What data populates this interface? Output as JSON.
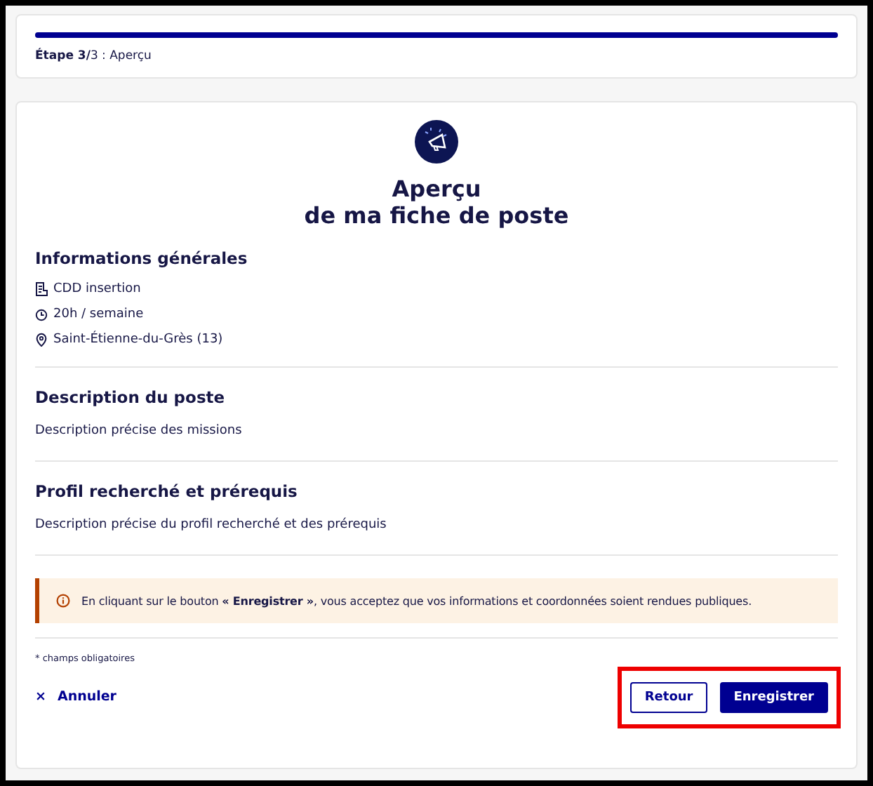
{
  "stepper": {
    "level": 1,
    "label": "**Étape 3/**3 : Aperçu"
  },
  "title_lines": [
    "Aperçu",
    "de ma fiche de poste"
  ],
  "general": {
    "heading": "Informations générales",
    "items": [
      {
        "kind": "contract",
        "text": "CDD insertion"
      },
      {
        "kind": "time",
        "text": "20h / semaine"
      },
      {
        "kind": "location",
        "text": "Saint-Étienne-du-Grès (13)"
      }
    ]
  },
  "sections": [
    {
      "heading": "Description du poste",
      "text": "Description précise des missions"
    },
    {
      "heading": "Profil recherché et prérequis",
      "text": "Description précise du profil recherché et des prérequis"
    }
  ],
  "notice": "En cliquant sur le bouton **« Enregistrer »**, vous acceptez que vos informations et coordonnées soient rendues publiques.",
  "required_note": "* champs obligatoires",
  "cancel": {
    "icon": "×",
    "label": "Annuler"
  },
  "buttons": [
    {
      "kind": "secondary",
      "label": "Retour"
    },
    {
      "kind": "primary",
      "label": "Enregistrer"
    }
  ]
}
